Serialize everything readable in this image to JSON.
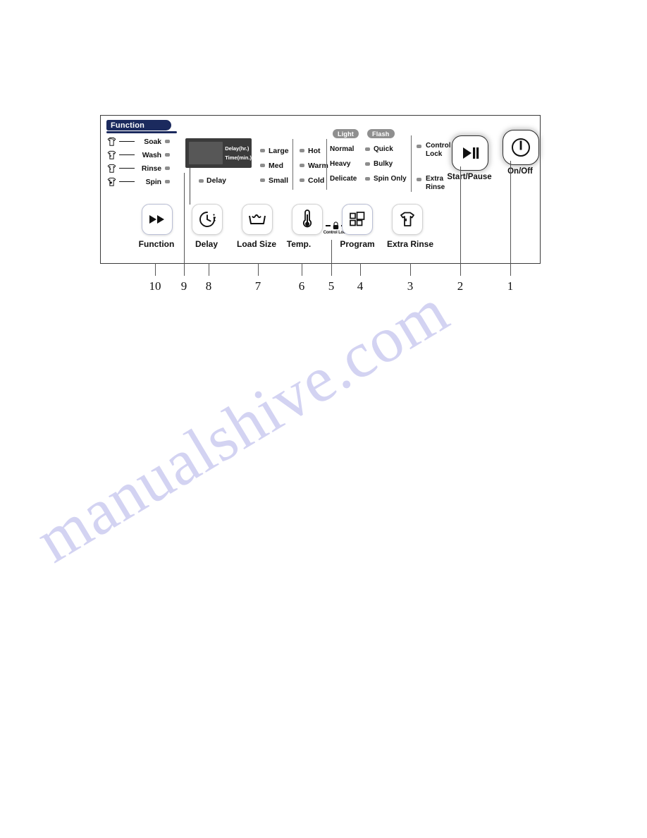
{
  "watermark": {
    "text": "manualshive.com"
  },
  "panel": {
    "function_group": {
      "tab_label": "Function",
      "rows": [
        {
          "label": "Soak",
          "icon": "shirt-soak-icon",
          "led": "led-indicator"
        },
        {
          "label": "Wash",
          "icon": "shirt-wash-icon",
          "led": "led-indicator"
        },
        {
          "label": "Rinse",
          "icon": "shirt-rinse-icon",
          "led": "led-indicator"
        },
        {
          "label": "Spin",
          "icon": "shirt-spin-icon",
          "led": "led-indicator"
        }
      ]
    },
    "display": {
      "line1": "Delay(hr.)",
      "line2": "Time(min.)",
      "delay_led_label": "Delay"
    },
    "load_size": {
      "options": [
        {
          "label": "Large"
        },
        {
          "label": "Med"
        },
        {
          "label": "Small"
        }
      ]
    },
    "temperature": {
      "options": [
        {
          "label": "Hot"
        },
        {
          "label": "Warm"
        },
        {
          "label": "Cold"
        }
      ]
    },
    "program": {
      "pills": [
        {
          "label": "Light"
        },
        {
          "label": "Flash"
        }
      ],
      "rows": [
        {
          "left": "Normal",
          "right": "Quick"
        },
        {
          "left": "Heavy",
          "right": "Bulky"
        },
        {
          "left": "Delicate",
          "right": "Spin Only"
        }
      ]
    },
    "indicators": [
      {
        "line1": "Control",
        "line2": "Lock"
      },
      {
        "line1": "Extra",
        "line2": "Rinse"
      }
    ],
    "main_buttons": [
      {
        "label": "Start/Pause",
        "icon": "play-pause-icon"
      },
      {
        "label": "On/Off",
        "icon": "power-icon"
      }
    ],
    "control_lock_mark": {
      "label": "Control Lock",
      "icon": "padlock-icon"
    },
    "buttons": [
      {
        "label": "Function",
        "icon": "fast-forward-icon",
        "highlight": true
      },
      {
        "label": "Delay",
        "icon": "clock-timer-icon",
        "highlight": false
      },
      {
        "label": "Load Size",
        "icon": "wash-basin-icon",
        "highlight": false
      },
      {
        "label": "Temp.",
        "icon": "thermometer-icon",
        "highlight": false
      },
      {
        "label": "Program",
        "icon": "grid-squares-icon",
        "highlight": true
      },
      {
        "label": "Extra Rinse",
        "icon": "shirt-drip-icon",
        "highlight": false
      }
    ]
  },
  "callouts": [
    {
      "number": "10"
    },
    {
      "number": "9"
    },
    {
      "number": "8"
    },
    {
      "number": "7"
    },
    {
      "number": "6"
    },
    {
      "number": "5"
    },
    {
      "number": "4"
    },
    {
      "number": "3"
    },
    {
      "number": "2"
    },
    {
      "number": "1"
    }
  ],
  "colors": {
    "panel_border": "#3a3a3a",
    "function_tab": "#1b2a5e",
    "led": "#8d8d8d",
    "pill": "#8f8f8f",
    "lcd": "#3b3b3b",
    "watermark": "#ccccf0",
    "button_highlight_border": "#b9bed4"
  }
}
